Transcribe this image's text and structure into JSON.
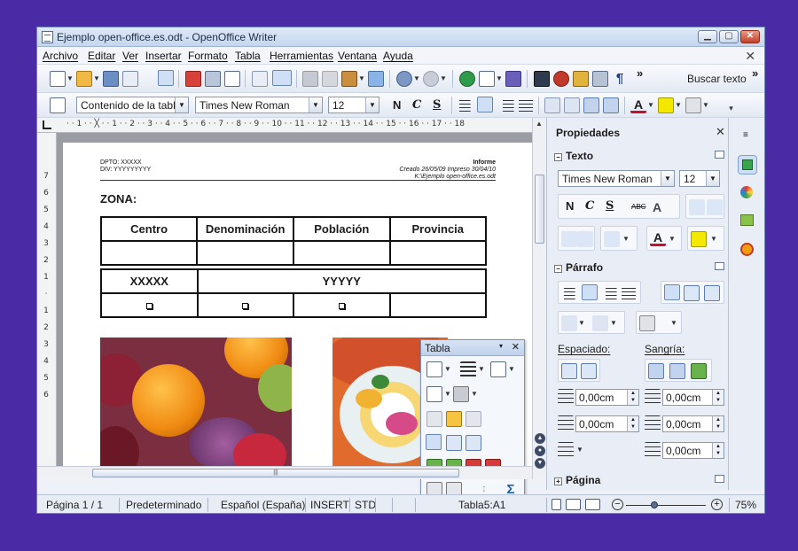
{
  "window": {
    "title": "Ejemplo open-office.es.odt - OpenOffice Writer",
    "btn_min": "▁",
    "btn_max": "▢",
    "btn_close": "✕"
  },
  "menu": {
    "items": [
      "Archivo",
      "Editar",
      "Ver",
      "Insertar",
      "Formato",
      "Tabla",
      "Herramientas",
      "Ventana",
      "Ayuda"
    ],
    "close": "✕"
  },
  "toolbar": {
    "search_label": "Buscar texto",
    "more": "»"
  },
  "format_bar": {
    "style": "Contenido de la tabla",
    "font": "Times New Roman",
    "size": "12",
    "bold": "N",
    "italic": "C",
    "underline": "S"
  },
  "ruler": {
    "h_ticks": "· · 1 · · ╳ · · 1 · · 2 · · 3 · · 4 · · 5 · · 6 · · 7 · · 8 · · 9 · · 10 · · 11 · · 12 · · 13 · · 14 · · 15 · · 16 · · 17 · · 18",
    "v_ticks": [
      "7",
      "6",
      "5",
      "4",
      "3",
      "2",
      "1",
      "·",
      "1",
      "2",
      "3",
      "4",
      "5",
      "6"
    ]
  },
  "document": {
    "header_left": [
      "DPTO: XXXXX",
      "DIV: YYYYYYYYY"
    ],
    "header_right_title": "Informe",
    "header_right_line2": "Creado 26/05/09 Impreso 30/04/10",
    "header_right_line3": "K:\\Ejemplo open-office.es.odt",
    "zona": "ZONA:",
    "table1_headers": [
      "Centro",
      "Denominación",
      "Población",
      "Provincia"
    ],
    "table2_left": "XXXXX",
    "table2_right": "YYYYY"
  },
  "float_toolbar": {
    "title": "Tabla",
    "menu": "▾",
    "close": "✕"
  },
  "sidebar": {
    "title": "Propiedades",
    "close": "✕",
    "texto_section": "Texto",
    "font": "Times New Roman",
    "size": "12",
    "bold": "N",
    "italic": "C",
    "underline": "S",
    "parrafo_section": "Párrafo",
    "espaciado": "Espaciado:",
    "sangria": "Sangría:",
    "spin_values": [
      "0,00cm",
      "0,00cm",
      "0,00cm",
      "0,00cm",
      "0,00cm"
    ],
    "pagina_section": "Página"
  },
  "status": {
    "page": "Página 1 / 1",
    "style": "Predeterminado",
    "language": "Español (España)",
    "insert": "INSERT",
    "std": "STD",
    "cell": "Tabla5:A1",
    "zoom": "75%"
  },
  "colors": {
    "background": "#4b2aa6",
    "accent": "#cfe0f6",
    "font_color_red": "#c8102e",
    "highlight_yellow": "#f5e800"
  }
}
